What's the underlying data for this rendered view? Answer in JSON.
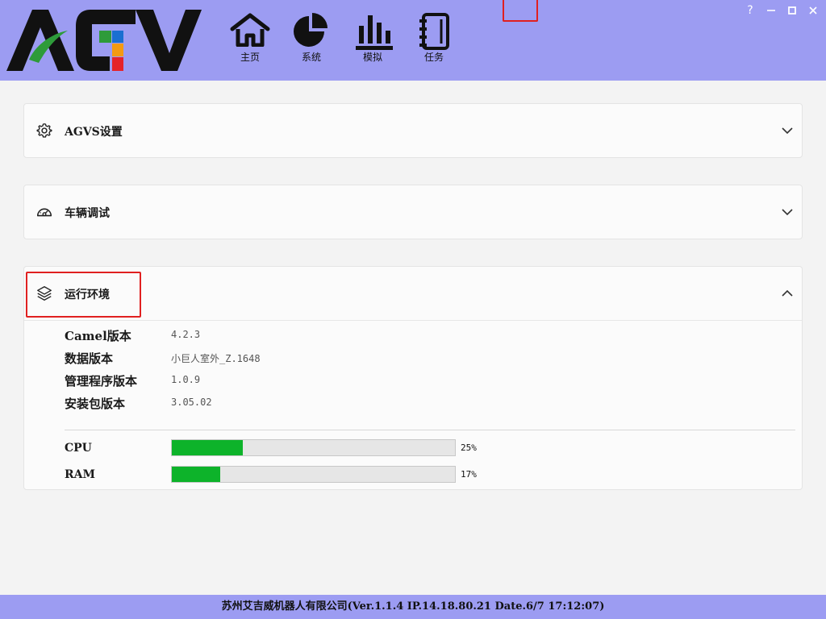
{
  "header": {
    "logo_text": "AGV",
    "nav": [
      {
        "label": "主页",
        "icon": "home-icon"
      },
      {
        "label": "系统",
        "icon": "pie-chart-icon"
      },
      {
        "label": "模拟",
        "icon": "bar-chart-icon"
      },
      {
        "label": "任务",
        "icon": "notebook-icon"
      }
    ],
    "window_controls": {
      "help": "?",
      "minimize": "—",
      "maximize": "□",
      "close": "✕"
    }
  },
  "panels": [
    {
      "title": "AGVS设置",
      "icon": "gear-icon",
      "expanded": false
    },
    {
      "title": "车辆调试",
      "icon": "speedometer-icon",
      "expanded": false
    },
    {
      "title": "运行环境",
      "icon": "layers-icon",
      "expanded": true
    }
  ],
  "environment": {
    "info": [
      {
        "label": "Camel版本",
        "value": "4.2.3"
      },
      {
        "label": "数据版本",
        "value": "小巨人室外_Z.1648"
      },
      {
        "label": "管理程序版本",
        "value": "1.0.9"
      },
      {
        "label": "安装包版本",
        "value": "3.05.02"
      }
    ],
    "meters": [
      {
        "label": "CPU",
        "value_text": "25%",
        "fraction": 0.25
      },
      {
        "label": "RAM",
        "value_text": "17%",
        "fraction": 0.17
      }
    ]
  },
  "footer": {
    "text": "苏州艾吉威机器人有限公司(Ver.1.1.4 IP.14.18.80.21 Date.6/7 17:12:07)"
  },
  "colors": {
    "header_bg": "#9c9cf2",
    "progress_fill": "#0db32a",
    "highlight": "#e02020",
    "logo_dark": "#111111",
    "logo_green": "#2e9b3a",
    "logo_blue": "#1a6fd1",
    "logo_orange": "#f39a12",
    "logo_red": "#e5232a"
  }
}
